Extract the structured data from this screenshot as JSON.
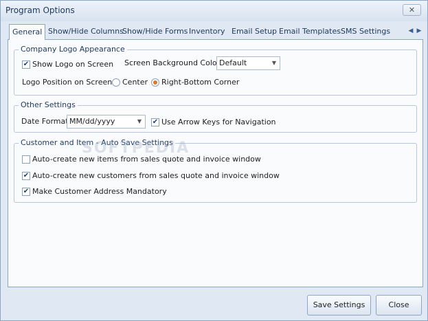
{
  "window": {
    "title": "Program Options",
    "close_label": "✕"
  },
  "tabs": [
    {
      "label": "General",
      "active": true
    },
    {
      "label": "Show/Hide Columns"
    },
    {
      "label": "Show/Hide Forms"
    },
    {
      "label": "Inventory"
    },
    {
      "label": "Email Setup"
    },
    {
      "label": "Email Templates"
    },
    {
      "label": "SMS Settings"
    }
  ],
  "tab_scroll": {
    "left": "◀",
    "right": "▶"
  },
  "logo_group": {
    "legend": "Company Logo Appearance",
    "show_logo": {
      "label": "Show Logo on Screen",
      "checked": true
    },
    "bg_color_label": "Screen Background Color",
    "bg_color_value": "Default",
    "position_label": "Logo Position on Screen",
    "radio_center": {
      "label": "Center",
      "selected": false
    },
    "radio_right_bottom": {
      "label": "Right-Bottom Corner",
      "selected": true
    }
  },
  "other_group": {
    "legend": "Other Settings",
    "date_format_label": "Date Format",
    "date_format_value": "MM/dd/yyyy",
    "arrow_keys": {
      "label": "Use Arrow Keys for Navigation",
      "checked": true
    }
  },
  "autosave_group": {
    "legend": "Customer and Item - Auto Save Settings",
    "items": [
      {
        "label": "Auto-create new items from sales quote and invoice window",
        "checked": false
      },
      {
        "label": "Auto-create new customers from sales quote and invoice window",
        "checked": true
      },
      {
        "label": "Make Customer Address Mandatory",
        "checked": true
      }
    ]
  },
  "watermark": "SOFTPEDIA",
  "footer": {
    "save_label": "Save Settings",
    "close_label": "Close"
  },
  "check_glyph": "✔",
  "dropdown_glyph": "▼"
}
